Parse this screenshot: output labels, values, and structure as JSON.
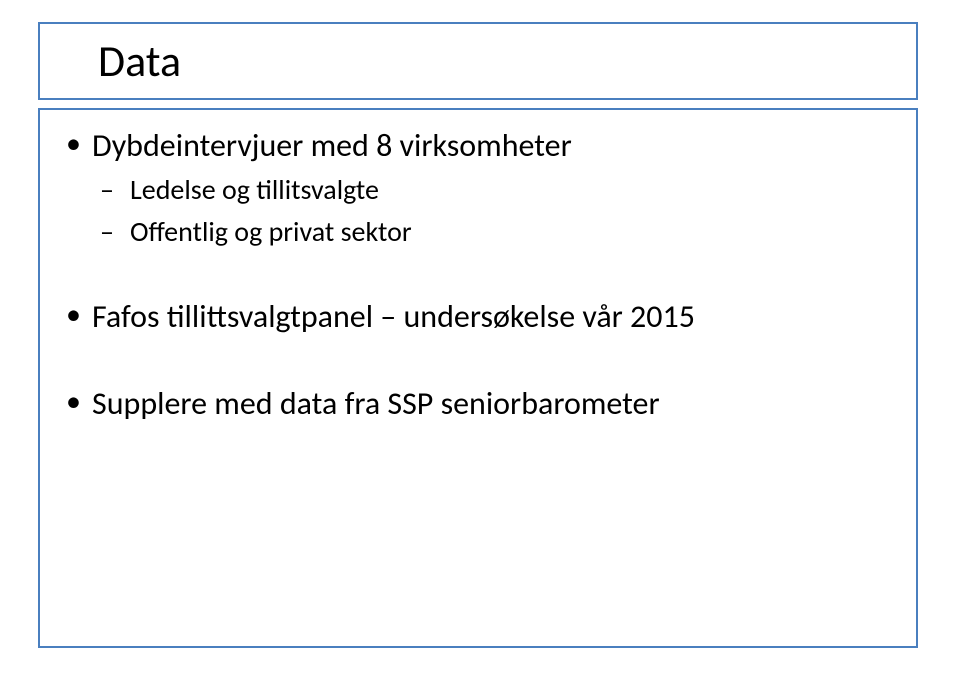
{
  "title": "Data",
  "bullets": [
    {
      "text": "Dybdeintervjuer med 8 virksomheter",
      "sub": [
        "Ledelse og tillitsvalgte",
        "Offentlig og privat sektor"
      ]
    },
    {
      "text": "Fafos tillittsvalgtpanel – undersøkelse vår 2015",
      "sub": []
    },
    {
      "text": "Supplere med data fra SSP seniorbarometer",
      "sub": []
    }
  ]
}
